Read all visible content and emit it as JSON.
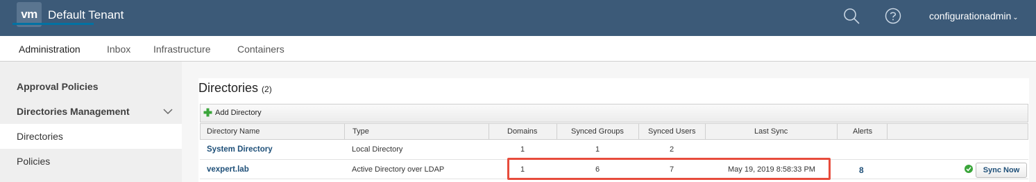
{
  "header": {
    "logo_text": "vm",
    "tenant": "Default Tenant",
    "user": "configurationadmin",
    "user_chevron": "⌄",
    "background": "#3c5a78"
  },
  "nav": {
    "tabs": [
      {
        "label": "Administration",
        "active": true
      },
      {
        "label": "Inbox"
      },
      {
        "label": "Infrastructure"
      },
      {
        "label": "Containers"
      }
    ],
    "active_color": "#0072a3"
  },
  "sidebar": {
    "items": [
      {
        "label": "Approval Policies"
      },
      {
        "label": "Directories Management"
      },
      {
        "label": "Directories",
        "selected": true
      },
      {
        "label": "Policies"
      }
    ]
  },
  "main": {
    "title": "Directories",
    "count": "(2)",
    "add_label": "Add Directory",
    "columns": [
      "Directory Name",
      "Type",
      "Domains",
      "Synced Groups",
      "Synced Users",
      "Last Sync",
      "Alerts"
    ],
    "rows": [
      {
        "name": "System Directory",
        "type": "Local Directory",
        "domains": "1",
        "groups": "1",
        "users": "2",
        "last_sync": "",
        "alerts": ""
      },
      {
        "name": "vexpert.lab",
        "type": "Active Directory over LDAP",
        "domains": "1",
        "groups": "6",
        "users": "7",
        "last_sync": "May 19, 2019 8:58:33 PM",
        "alerts": "8"
      }
    ],
    "sync_button": "Sync Now",
    "highlight_color": "#e74c3c"
  }
}
